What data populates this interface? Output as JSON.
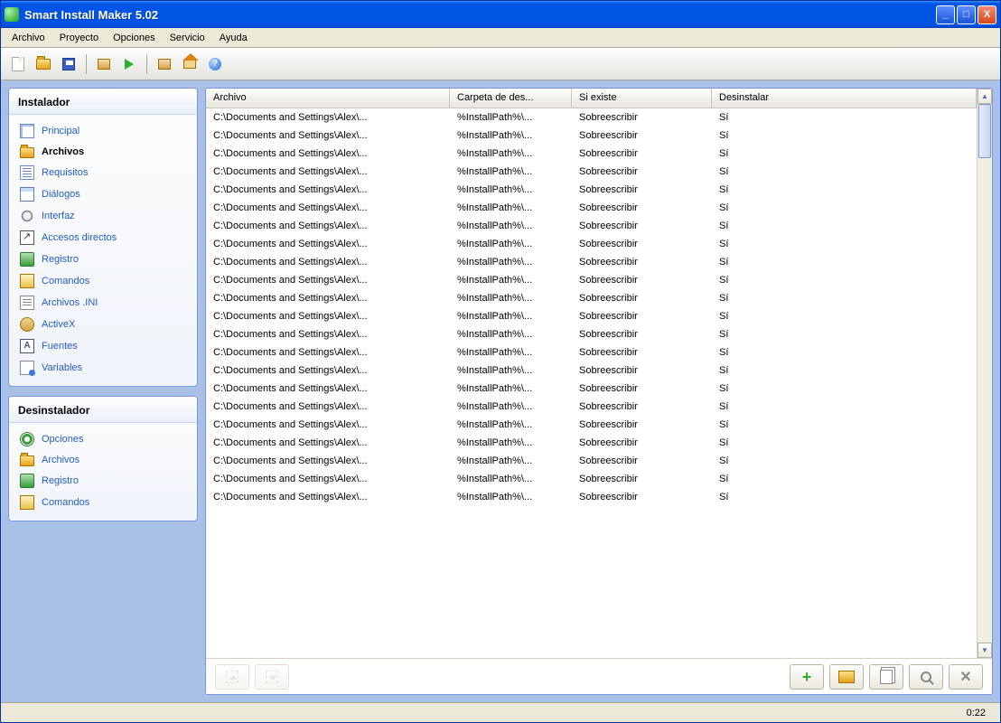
{
  "window": {
    "title": "Smart Install Maker 5.02"
  },
  "menu": {
    "archivo": "Archivo",
    "proyecto": "Proyecto",
    "opciones": "Opciones",
    "servicio": "Servicio",
    "ayuda": "Ayuda"
  },
  "sidebar": {
    "installer": {
      "title": "Instalador",
      "items": [
        {
          "label": "Principal",
          "icon": "ic-page"
        },
        {
          "label": "Archivos",
          "icon": "ic-folder",
          "active": true
        },
        {
          "label": "Requisitos",
          "icon": "ic-list"
        },
        {
          "label": "Diálogos",
          "icon": "ic-dialog"
        },
        {
          "label": "Interfaz",
          "icon": "ic-interface"
        },
        {
          "label": "Accesos directos",
          "icon": "ic-shortcut"
        },
        {
          "label": "Registro",
          "icon": "ic-registry"
        },
        {
          "label": "Comandos",
          "icon": "ic-cmd"
        },
        {
          "label": "Archivos .INI",
          "icon": "ic-ini"
        },
        {
          "label": "ActiveX",
          "icon": "ic-activex"
        },
        {
          "label": "Fuentes",
          "icon": "ic-font"
        },
        {
          "label": "Variables",
          "icon": "ic-var"
        }
      ]
    },
    "uninstaller": {
      "title": "Desinstalador",
      "items": [
        {
          "label": "Opciones",
          "icon": "ic-opts"
        },
        {
          "label": "Archivos",
          "icon": "ic-folder"
        },
        {
          "label": "Registro",
          "icon": "ic-registry"
        },
        {
          "label": "Comandos",
          "icon": "ic-cmd"
        }
      ]
    }
  },
  "table": {
    "columns": {
      "archivo": "Archivo",
      "carpeta": "Carpeta de des...",
      "siexiste": "Si existe",
      "desinstalar": "Desinstalar"
    },
    "row_template": {
      "archivo": "C:\\Documents and Settings\\Alex\\...",
      "carpeta": "%InstallPath%\\...",
      "siexiste": "Sobreescribir",
      "desinstalar": "Sí"
    },
    "row_count": 22
  },
  "status": {
    "time": "0:22"
  }
}
